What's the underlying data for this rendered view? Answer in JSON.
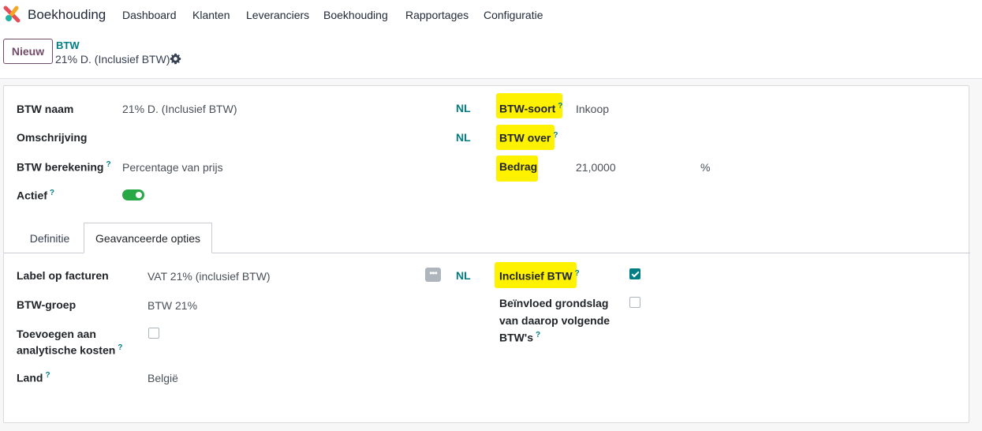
{
  "navbar": {
    "app_name": "Boekhouding",
    "items": [
      "Dashboard",
      "Klanten",
      "Leveranciers",
      "Boekhouding",
      "Rapportages",
      "Configuratie"
    ]
  },
  "control": {
    "new_button": "Nieuw",
    "breadcrumb_parent": "BTW",
    "breadcrumb_current": "21% D. (Inclusief BTW)"
  },
  "form": {
    "name_label": "BTW naam",
    "name_value": "21% D. (Inclusief BTW)",
    "description_label": "Omschrijving",
    "description_value": "",
    "computation_label": "BTW berekening",
    "computation_value": "Percentage van prijs",
    "active_label": "Actief",
    "active_value": true,
    "lang_badge": "NL",
    "type_label": "BTW-soort",
    "type_value": "Inkoop",
    "scope_label": "BTW over",
    "scope_value": "",
    "amount_label": "Bedrag",
    "amount_value": "21,0000",
    "amount_unit": "%",
    "help_mark": "?"
  },
  "tabs": [
    {
      "label": "Definitie",
      "active": false
    },
    {
      "label": "Geavanceerde opties",
      "active": true
    }
  ],
  "advanced": {
    "invoice_label_label": "Label op facturen",
    "invoice_label_value": "VAT 21% (inclusief BTW)",
    "tax_group_label": "BTW-groep",
    "tax_group_value": "BTW 21%",
    "analytic_label_line1": "Toevoegen aan",
    "analytic_label_line2": "analytische kosten",
    "analytic_checked": false,
    "country_label": "Land",
    "country_value": "België",
    "price_include_label": "Inclusief BTW",
    "price_include_checked": true,
    "affect_base_line1": "Beïnvloed grondslag",
    "affect_base_line2": "van daarop volgende",
    "affect_base_line3": "BTW's",
    "affect_base_checked": false
  },
  "colors": {
    "highlight": "#fff200",
    "brand": "#714b67",
    "teal": "#017e84",
    "toggle_on": "#28a745"
  }
}
